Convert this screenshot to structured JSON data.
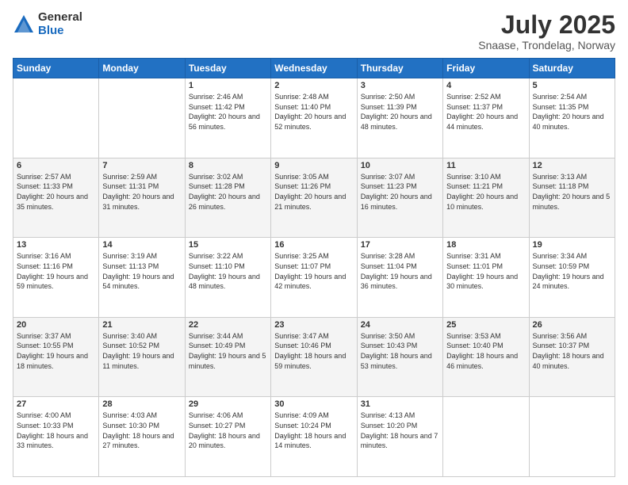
{
  "logo": {
    "general": "General",
    "blue": "Blue"
  },
  "title": "July 2025",
  "subtitle": "Snaase, Trondelag, Norway",
  "days_header": [
    "Sunday",
    "Monday",
    "Tuesday",
    "Wednesday",
    "Thursday",
    "Friday",
    "Saturday"
  ],
  "weeks": [
    [
      {
        "num": "",
        "info": ""
      },
      {
        "num": "",
        "info": ""
      },
      {
        "num": "1",
        "info": "Sunrise: 2:46 AM\nSunset: 11:42 PM\nDaylight: 20 hours and 56 minutes."
      },
      {
        "num": "2",
        "info": "Sunrise: 2:48 AM\nSunset: 11:40 PM\nDaylight: 20 hours and 52 minutes."
      },
      {
        "num": "3",
        "info": "Sunrise: 2:50 AM\nSunset: 11:39 PM\nDaylight: 20 hours and 48 minutes."
      },
      {
        "num": "4",
        "info": "Sunrise: 2:52 AM\nSunset: 11:37 PM\nDaylight: 20 hours and 44 minutes."
      },
      {
        "num": "5",
        "info": "Sunrise: 2:54 AM\nSunset: 11:35 PM\nDaylight: 20 hours and 40 minutes."
      }
    ],
    [
      {
        "num": "6",
        "info": "Sunrise: 2:57 AM\nSunset: 11:33 PM\nDaylight: 20 hours and 35 minutes."
      },
      {
        "num": "7",
        "info": "Sunrise: 2:59 AM\nSunset: 11:31 PM\nDaylight: 20 hours and 31 minutes."
      },
      {
        "num": "8",
        "info": "Sunrise: 3:02 AM\nSunset: 11:28 PM\nDaylight: 20 hours and 26 minutes."
      },
      {
        "num": "9",
        "info": "Sunrise: 3:05 AM\nSunset: 11:26 PM\nDaylight: 20 hours and 21 minutes."
      },
      {
        "num": "10",
        "info": "Sunrise: 3:07 AM\nSunset: 11:23 PM\nDaylight: 20 hours and 16 minutes."
      },
      {
        "num": "11",
        "info": "Sunrise: 3:10 AM\nSunset: 11:21 PM\nDaylight: 20 hours and 10 minutes."
      },
      {
        "num": "12",
        "info": "Sunrise: 3:13 AM\nSunset: 11:18 PM\nDaylight: 20 hours and 5 minutes."
      }
    ],
    [
      {
        "num": "13",
        "info": "Sunrise: 3:16 AM\nSunset: 11:16 PM\nDaylight: 19 hours and 59 minutes."
      },
      {
        "num": "14",
        "info": "Sunrise: 3:19 AM\nSunset: 11:13 PM\nDaylight: 19 hours and 54 minutes."
      },
      {
        "num": "15",
        "info": "Sunrise: 3:22 AM\nSunset: 11:10 PM\nDaylight: 19 hours and 48 minutes."
      },
      {
        "num": "16",
        "info": "Sunrise: 3:25 AM\nSunset: 11:07 PM\nDaylight: 19 hours and 42 minutes."
      },
      {
        "num": "17",
        "info": "Sunrise: 3:28 AM\nSunset: 11:04 PM\nDaylight: 19 hours and 36 minutes."
      },
      {
        "num": "18",
        "info": "Sunrise: 3:31 AM\nSunset: 11:01 PM\nDaylight: 19 hours and 30 minutes."
      },
      {
        "num": "19",
        "info": "Sunrise: 3:34 AM\nSunset: 10:59 PM\nDaylight: 19 hours and 24 minutes."
      }
    ],
    [
      {
        "num": "20",
        "info": "Sunrise: 3:37 AM\nSunset: 10:55 PM\nDaylight: 19 hours and 18 minutes."
      },
      {
        "num": "21",
        "info": "Sunrise: 3:40 AM\nSunset: 10:52 PM\nDaylight: 19 hours and 11 minutes."
      },
      {
        "num": "22",
        "info": "Sunrise: 3:44 AM\nSunset: 10:49 PM\nDaylight: 19 hours and 5 minutes."
      },
      {
        "num": "23",
        "info": "Sunrise: 3:47 AM\nSunset: 10:46 PM\nDaylight: 18 hours and 59 minutes."
      },
      {
        "num": "24",
        "info": "Sunrise: 3:50 AM\nSunset: 10:43 PM\nDaylight: 18 hours and 53 minutes."
      },
      {
        "num": "25",
        "info": "Sunrise: 3:53 AM\nSunset: 10:40 PM\nDaylight: 18 hours and 46 minutes."
      },
      {
        "num": "26",
        "info": "Sunrise: 3:56 AM\nSunset: 10:37 PM\nDaylight: 18 hours and 40 minutes."
      }
    ],
    [
      {
        "num": "27",
        "info": "Sunrise: 4:00 AM\nSunset: 10:33 PM\nDaylight: 18 hours and 33 minutes."
      },
      {
        "num": "28",
        "info": "Sunrise: 4:03 AM\nSunset: 10:30 PM\nDaylight: 18 hours and 27 minutes."
      },
      {
        "num": "29",
        "info": "Sunrise: 4:06 AM\nSunset: 10:27 PM\nDaylight: 18 hours and 20 minutes."
      },
      {
        "num": "30",
        "info": "Sunrise: 4:09 AM\nSunset: 10:24 PM\nDaylight: 18 hours and 14 minutes."
      },
      {
        "num": "31",
        "info": "Sunrise: 4:13 AM\nSunset: 10:20 PM\nDaylight: 18 hours and 7 minutes."
      },
      {
        "num": "",
        "info": ""
      },
      {
        "num": "",
        "info": ""
      }
    ]
  ]
}
